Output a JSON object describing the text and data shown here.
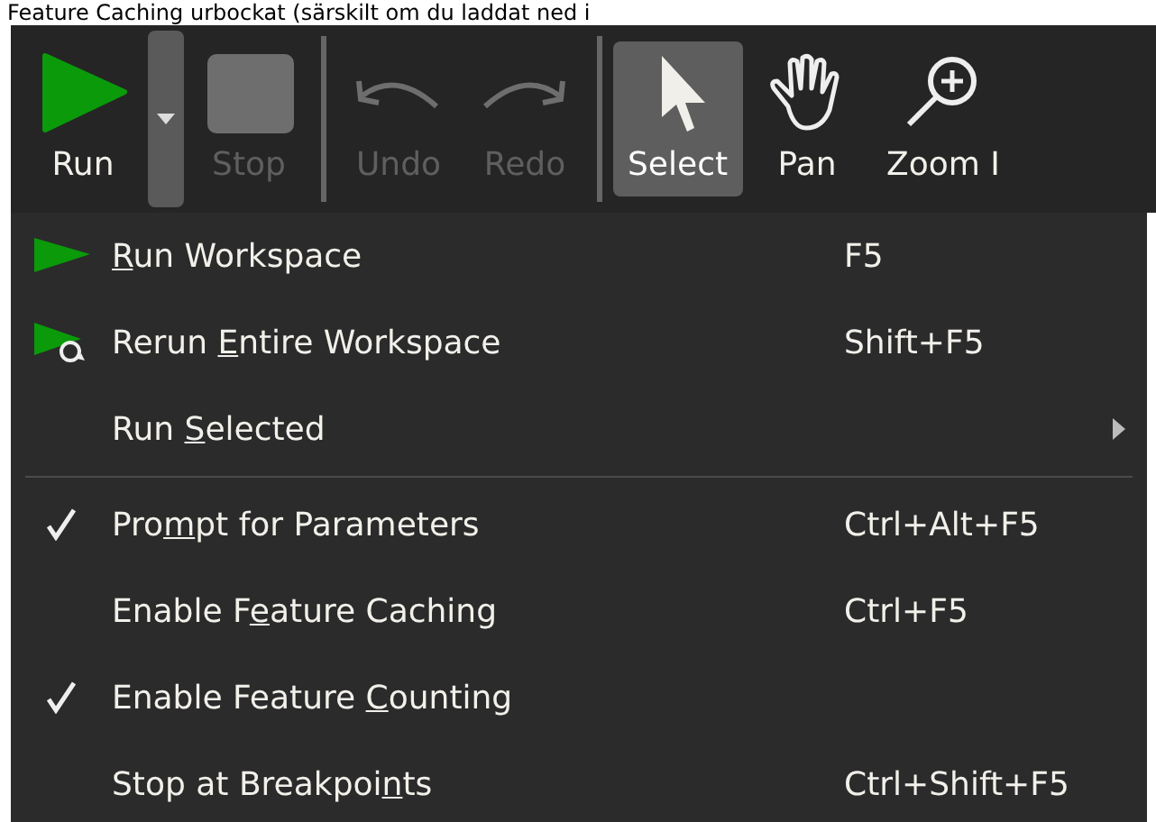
{
  "caption": "Feature Caching urbockat (särskilt om du laddat ned i",
  "toolbar": [
    {
      "kind": "run",
      "label": "Run",
      "disabled": false,
      "selected": false
    },
    {
      "kind": "dropdown"
    },
    {
      "kind": "stop",
      "label": "Stop",
      "disabled": true,
      "selected": false
    },
    {
      "kind": "separator"
    },
    {
      "kind": "undo",
      "label": "Undo",
      "disabled": true,
      "selected": false
    },
    {
      "kind": "redo",
      "label": "Redo",
      "disabled": true,
      "selected": false
    },
    {
      "kind": "separator"
    },
    {
      "kind": "select",
      "label": "Select",
      "disabled": false,
      "selected": true
    },
    {
      "kind": "pan",
      "label": "Pan",
      "disabled": false,
      "selected": false
    },
    {
      "kind": "zoom",
      "label": "Zoom I",
      "disabled": false,
      "selected": false
    }
  ],
  "menu": [
    {
      "kind": "run",
      "mnemonic": "R",
      "label_after": "un Workspace",
      "shortcut": "F5"
    },
    {
      "kind": "rerun",
      "label_before": "Rerun ",
      "mnemonic": "E",
      "label_after": "ntire Workspace",
      "shortcut": "Shift+F5"
    },
    {
      "kind": "submenu",
      "label_before": "Run ",
      "mnemonic": "S",
      "label_after": "elected"
    },
    {
      "kind": "separator"
    },
    {
      "kind": "toggle",
      "label_before": "Pro",
      "mnemonic": "m",
      "label_after": "pt for Parameters",
      "shortcut": "Ctrl+Alt+F5",
      "checked": true
    },
    {
      "kind": "toggle",
      "label_before": "Enable F",
      "mnemonic": "e",
      "label_after": "ature Caching",
      "shortcut": "Ctrl+F5",
      "checked": false
    },
    {
      "kind": "toggle",
      "label_before": "Enable Feature ",
      "mnemonic": "C",
      "label_after": "ounting",
      "checked": true
    },
    {
      "kind": "toggle",
      "label_before": "Stop at Breakpoi",
      "mnemonic": "n",
      "label_after": "ts",
      "shortcut": "Ctrl+Shift+F5",
      "checked": false
    }
  ]
}
